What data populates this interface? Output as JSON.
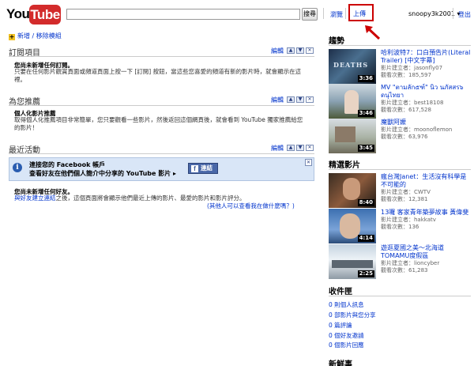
{
  "header": {
    "logo_you": "You",
    "logo_tube": "Tube",
    "search_button": "搜尋",
    "nav": {
      "browse": "瀏覽",
      "upload": "上傳"
    },
    "user": "snoopy3k2001 ▾",
    "logout": "登出"
  },
  "left": {
    "add_remove": "新增 / 移除模組",
    "subscriptions": {
      "title": "訂閱項目",
      "edit": "編輯",
      "empty_bold": "您尚未新增任何訂閱。",
      "empty_text": "只要在任何影片觀賞頁面或頻道頁面上按一下 [訂閱] 按鈕，當這些您喜愛的頻道有新的影片時，就會顯示在這裡。"
    },
    "recommended": {
      "title": "為您推薦",
      "edit": "編輯",
      "bold": "個人化影片推薦",
      "text": "取得個人化推薦項目非常簡單，您只要觀看一些影片，然後返回這個網頁後，就會看到 YouTube 獨家推薦給您的影片！"
    },
    "activity": {
      "title": "最近活動",
      "edit": "編輯",
      "fb_line1": "連接您的 Facebook 帳戶",
      "fb_line2": "查看好友在他們個人簡介中分享的 YouTube 影片 ▸",
      "fb_button": "連結",
      "no_friends_bold": "您尚未新增任何好友。",
      "no_friends_link": "與好友建立連結",
      "no_friends_text": "之後，這個頁面將會顯示他們最近上傳的影片、最愛的影片和影片評分。",
      "who_link": "(其他人可以查看我在做什麼嗎？)"
    }
  },
  "right": {
    "trending": {
      "title": "趨勢",
      "videos": [
        {
          "title": "哈利波特7：口白預告片(Literal Trailer) [中文字幕]",
          "uploader": "影片建立者：jasonfly07",
          "views": "觀看次數：185,597",
          "duration": "3:36"
        },
        {
          "title": "MV \"ตามลัก๕ฑ์\" นิว นภัสสร๖ ดนุไทยา",
          "uploader": "影片建立者：best18108",
          "views": "觀看次數：617,528",
          "duration": "3:46"
        },
        {
          "title": "魔獸阿嬤",
          "uploader": "影片建立者：moonoflemon",
          "views": "觀看次數：63,976",
          "duration": "3:45"
        }
      ]
    },
    "featured": {
      "title": "精選影片",
      "videos": [
        {
          "title": "瘋台灣Janet：生活沒有科學是不可能的",
          "uploader": "影片建立者：CWTV",
          "views": "觀看次數：12,381",
          "duration": "8:40"
        },
        {
          "title": "13囉 客家青年築夢故事 黃偉斐",
          "uploader": "影片建立者：hakkatv",
          "views": "觀看次數：136",
          "duration": "4:14"
        },
        {
          "title": "遊逛夏國之美～北海道TOMAMU度假區",
          "uploader": "影片建立者：lioncyber",
          "views": "觀看次數：61,283",
          "duration": "2:25"
        }
      ]
    },
    "inbox": {
      "title": "收件匣",
      "items": [
        "0 則個人訊息",
        "0 部影片與您分享",
        "0 篇評論",
        "0 個好友邀請",
        "0 個影片回應"
      ]
    },
    "whats_new": {
      "title": "新鮮事"
    }
  },
  "colors": {
    "link": "#0033cc",
    "logo_red": "#d32b2b",
    "highlight": "#cc0000",
    "fb_blue": "#4a68a8",
    "panel": "#d9e6f7"
  }
}
